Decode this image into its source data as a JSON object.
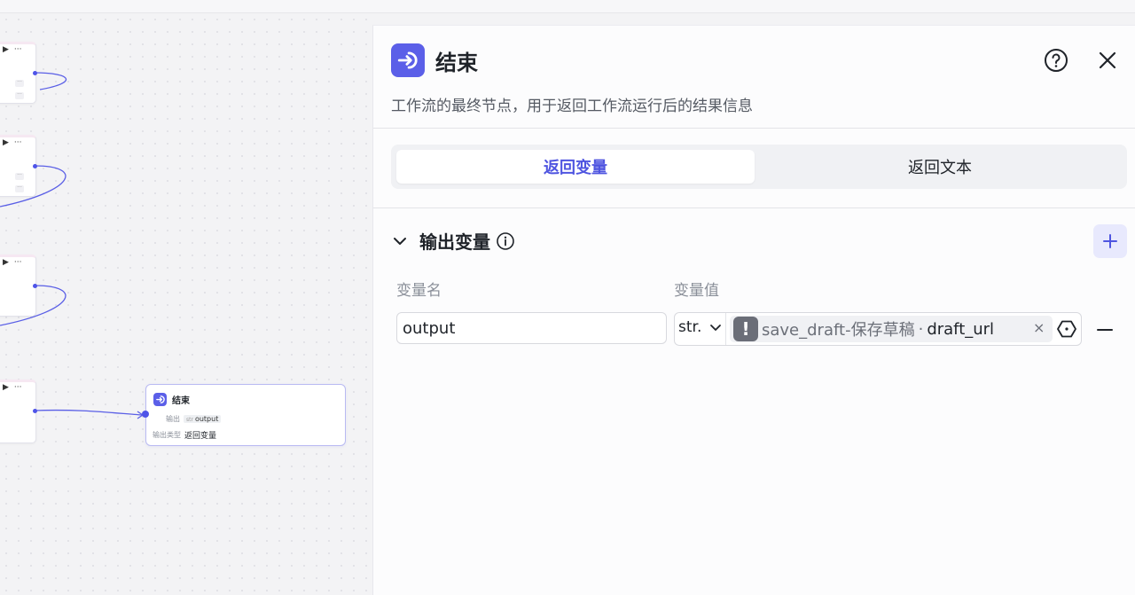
{
  "canvas": {
    "end_node": {
      "title": "结束",
      "output_label": "输出",
      "output_type": "str",
      "output_name": "output",
      "mode_label": "输出类型",
      "mode_value": "返回变量"
    }
  },
  "panel": {
    "title": "结束",
    "description": "工作流的最终节点，用于返回工作流运行后的结果信息",
    "tabs": [
      {
        "label": "返回变量",
        "active": true
      },
      {
        "label": "返回文本",
        "active": false
      }
    ],
    "section": {
      "title": "输出变量",
      "col_name": "变量名",
      "col_value": "变量值",
      "rows": [
        {
          "name": "output",
          "type": "str.",
          "ref_source": "save_draft-保存草稿",
          "ref_sep": "·",
          "ref_field": "draft_url",
          "clear": "×",
          "warning": "!"
        }
      ]
    }
  },
  "colors": {
    "accent": "#4f55e0",
    "node_icon": "#5b5fe8",
    "edge": "#4e54e8"
  }
}
